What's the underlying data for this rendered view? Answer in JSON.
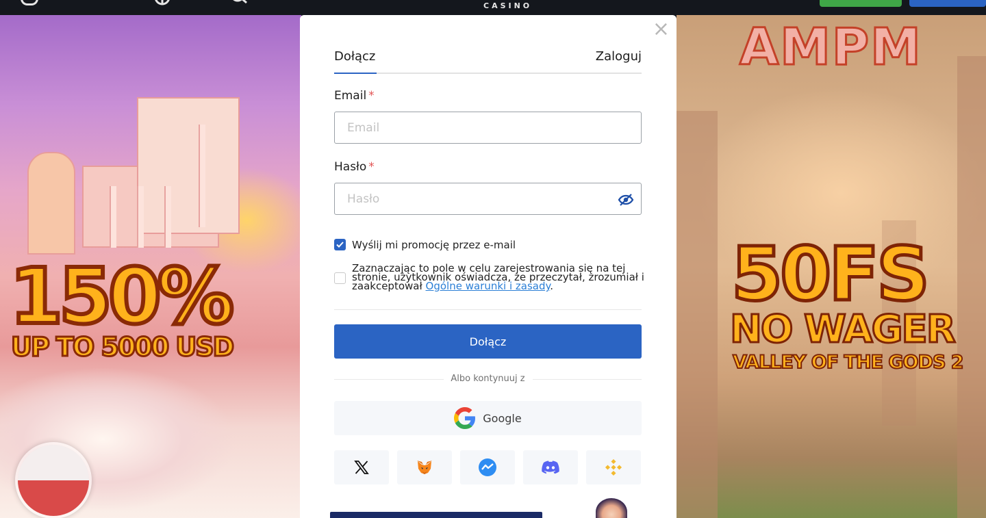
{
  "topbar": {
    "brand": "CASINO",
    "icons": [
      "instagram-icon",
      "globe-icon",
      "search-icon"
    ],
    "register_button_color": "#3fa647",
    "login_button_color": "#2b64c3"
  },
  "promo_left": {
    "headline": "150%",
    "subline": "UP TO 5000 USD",
    "flag": "poland-flag"
  },
  "promo_right": {
    "logo": "AMPM",
    "headline": "50FS",
    "subline": "NO WAGER",
    "game": "VALLEY OF THE GODS 2"
  },
  "modal": {
    "close_symbol": "×",
    "tabs": [
      {
        "label": "Dołącz",
        "active": true
      },
      {
        "label": "Zaloguj",
        "active": false
      }
    ],
    "email": {
      "label": "Email",
      "required_mark": "*",
      "value": "",
      "placeholder": "Email"
    },
    "password": {
      "label": "Hasło",
      "required_mark": "*",
      "value": "",
      "placeholder": "Hasło",
      "toggle_icon": "eye-slash-icon"
    },
    "promo_checkbox": {
      "checked": true,
      "label": "Wyślij mi promocję przez e-mail"
    },
    "terms_checkbox": {
      "checked": false,
      "text": "Zaznaczając to pole w celu zarejestrowania się na tej stronie, użytkownik oświadcza, że przeczytał, zrozumiał i zaakceptował",
      "link": "Ogólne warunki i zasady",
      "suffix": "."
    },
    "submit_label": "Dołącz",
    "or_text": "Albo kontynuuj z",
    "google_label": "Google",
    "social": [
      "x-icon",
      "metamask-icon",
      "messenger-icon",
      "discord-icon",
      "binance-icon"
    ],
    "accent_color": "#2b64c3"
  }
}
